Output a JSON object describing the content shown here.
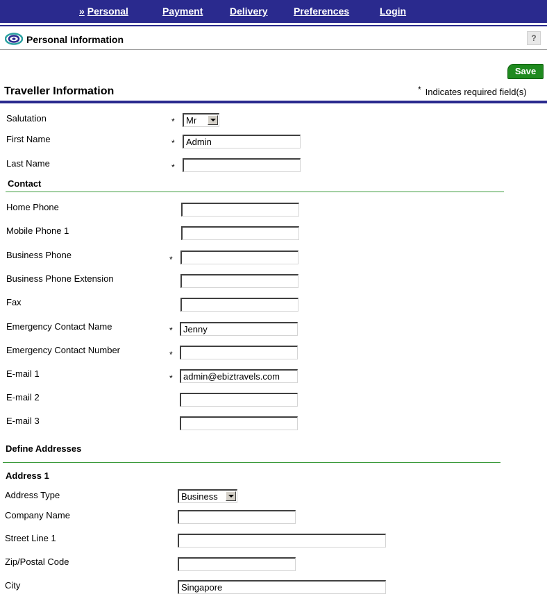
{
  "nav": {
    "chevron": "»",
    "personal": "Personal",
    "payment": "Payment",
    "delivery": "Delivery",
    "preferences": "Preferences",
    "login": "Login"
  },
  "header": {
    "title": "Personal Information",
    "help": "?"
  },
  "toolbar": {
    "save_label": "Save"
  },
  "traveller": {
    "section_title": "Traveller Information",
    "required_star": "*",
    "required_note": "Indicates required field(s)",
    "salutation_label": "Salutation",
    "salutation_value": "Mr",
    "first_name_label": "First Name",
    "first_name_value": "Admin",
    "last_name_label": "Last Name",
    "last_name_value": ""
  },
  "contact": {
    "heading": "Contact",
    "home_phone_label": "Home Phone",
    "mobile_phone_label": "Mobile Phone 1",
    "business_phone_label": "Business Phone",
    "business_ext_label": "Business Phone Extension",
    "fax_label": "Fax",
    "emergency_name_label": "Emergency Contact Name",
    "emergency_name_value": "Jenny",
    "emergency_number_label": "Emergency Contact Number",
    "email1_label": "E-mail 1",
    "email1_value": "admin@ebiztravels.com",
    "email2_label": "E-mail 2",
    "email3_label": "E-mail 3"
  },
  "addresses": {
    "heading": "Define Addresses",
    "address1_heading": "Address 1",
    "type_label": "Address Type",
    "type_value": "Business",
    "company_label": "Company Name",
    "street_label": "Street Line 1",
    "zip_label": "Zip/Postal Code",
    "city_label": "City",
    "city_value": "Singapore"
  },
  "colors": {
    "nav_bg": "#2a2a8e",
    "save_bg": "#1f8a1f",
    "rule_green": "#3a9a3a"
  }
}
